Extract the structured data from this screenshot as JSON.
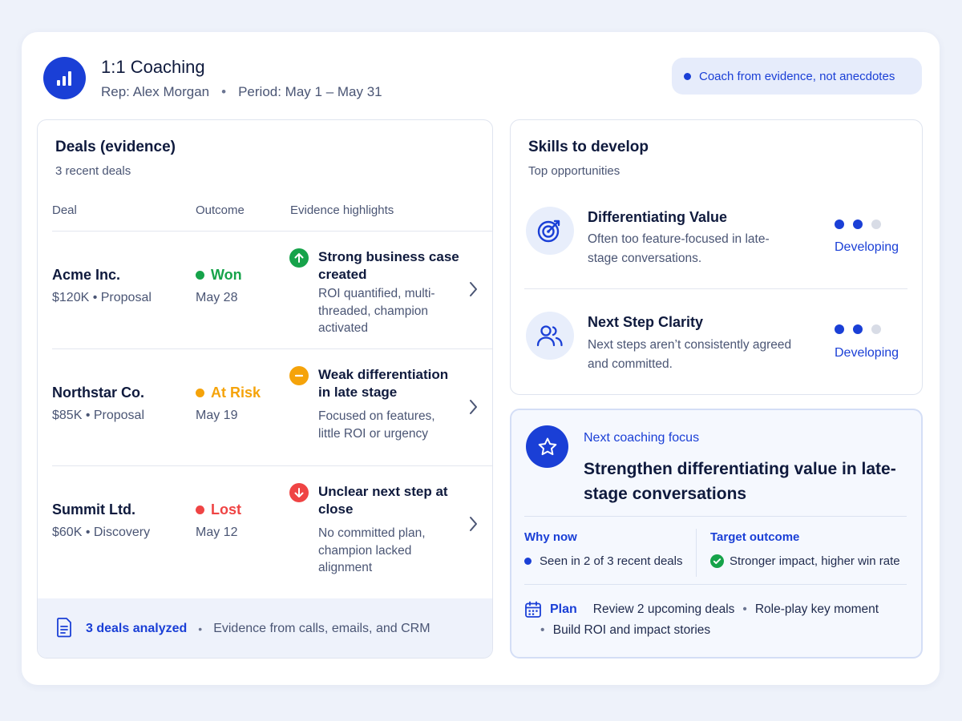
{
  "header": {
    "title": "1:1 Coaching",
    "rep": "Rep: Alex Morgan",
    "separator": "•",
    "period": "Period: May 1 – May 31",
    "logo_icon": "bar-chart-icon",
    "pill": "Coach from evidence, not anecdotes"
  },
  "deals": {
    "title": "Deals (evidence)",
    "subtitle": "3 recent deals",
    "columns": [
      "Deal",
      "Outcome",
      "Evidence highlights"
    ],
    "rows": [
      {
        "name": "Acme Inc.",
        "amount": "$120K",
        "stage": "Proposal",
        "meta": "$120K • Proposal",
        "outcome": "Won",
        "outcome_color": "#16a34a",
        "date": "May 28",
        "evidence_icon": "arrow-up-icon",
        "evidence_title": "Strong business case created",
        "evidence_desc": "ROI quantified, multi-threaded, champion activated"
      },
      {
        "name": "Northstar Co.",
        "amount": "$85K",
        "stage": "Proposal",
        "meta": "$85K • Proposal",
        "outcome": "At Risk",
        "outcome_color": "#f5a30a",
        "date": "May 19",
        "evidence_icon": "minus-icon",
        "evidence_title": "Weak differentiation in late stage",
        "evidence_desc": "Focused on features, little ROI or urgency"
      },
      {
        "name": "Summit Ltd.",
        "amount": "$60K",
        "stage": "Discovery",
        "meta": "$60K • Discovery",
        "outcome": "Lost",
        "outcome_color": "#ef4444",
        "date": "May 12",
        "evidence_icon": "arrow-down-icon",
        "evidence_title": "Unclear next step at close",
        "evidence_desc": "No committed plan, champion lacked alignment"
      }
    ],
    "footer": {
      "icon": "document-icon",
      "count": "3 deals analyzed",
      "separator": "•",
      "source": "Evidence from calls, emails, and CRM"
    }
  },
  "skills": {
    "title": "Skills to develop",
    "subtitle": "Top opportunities",
    "items": [
      {
        "name": "Differentiating Value",
        "icon": "target-icon",
        "desc": "Often too feature-focused in late-stage conversations.",
        "level": "Developing",
        "level_value": 2,
        "level_max": 3
      },
      {
        "name": "Next Step Clarity",
        "icon": "users-icon",
        "desc": "Next steps aren’t consistently agreed and committed.",
        "level": "Developing",
        "level_value": 2,
        "level_max": 3
      }
    ]
  },
  "focus": {
    "icon": "star-icon",
    "label": "Next coaching focus",
    "headline": "Strengthen differentiating value in late-stage conversations",
    "why_now_label": "Why now",
    "why_now_value": "Seen in 2 of 3 recent deals",
    "target_label": "Target outcome",
    "target_value": "Stronger impact, higher win rate",
    "plan_label": "Plan",
    "plan_items": [
      "Review 2 upcoming deals",
      "Role-play key moment",
      "Build ROI and impact stories"
    ],
    "separator": "•"
  },
  "colors": {
    "accent": "#1a3fd6",
    "background": "#eef2fa",
    "won": "#16a34a",
    "at_risk": "#f5a30a",
    "lost": "#ef4444"
  }
}
